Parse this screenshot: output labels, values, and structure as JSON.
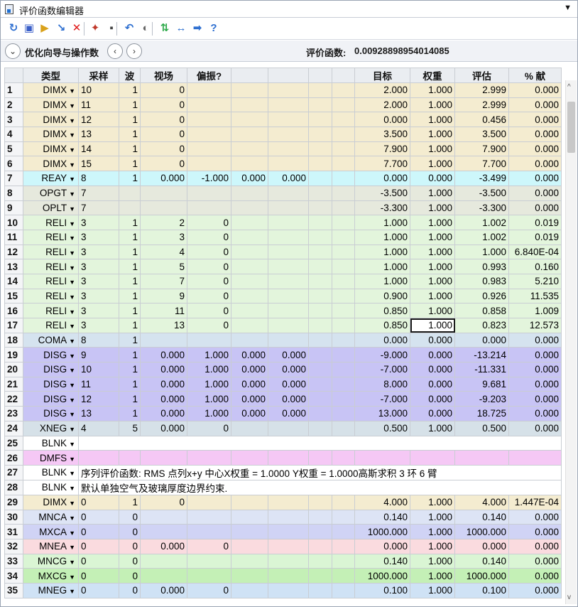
{
  "window": {
    "title": "评价函数编辑器",
    "dropdown_glyph": "▼"
  },
  "toolbar": {
    "buttons": [
      {
        "name": "refresh-icon",
        "glyph": "↻",
        "color": "#2e6fd0"
      },
      {
        "name": "save-icon",
        "glyph": "▣",
        "color": "#3a5fc8"
      },
      {
        "name": "load-icon",
        "glyph": "▶",
        "color": "#d9a11a"
      },
      {
        "name": "arrow-down-right-icon",
        "glyph": "↘",
        "color": "#2e6fd0"
      },
      {
        "name": "delete-icon",
        "glyph": "✕",
        "color": "#e01b1b"
      },
      {
        "name": "wizard-wand-icon",
        "glyph": "✦",
        "color": "#c0392b"
      },
      {
        "name": "page-icon",
        "glyph": "▪",
        "color": "#444444"
      },
      {
        "name": "undo-curve-icon",
        "glyph": "↶",
        "color": "#2e6fd0"
      },
      {
        "name": "toggle-icon",
        "glyph": "◐",
        "color": "#666666"
      },
      {
        "name": "swap-icon",
        "glyph": "⇅",
        "color": "#2eaa4b"
      },
      {
        "name": "expand-horizontal-icon",
        "glyph": "↔",
        "color": "#2e6fd0"
      },
      {
        "name": "arrow-right-icon",
        "glyph": "➡",
        "color": "#2e6fd0"
      },
      {
        "name": "help-icon",
        "glyph": "?",
        "color": "#2e6fd0"
      }
    ]
  },
  "wizard": {
    "toggle_glyph": "⌄",
    "label": "优化向导与操作数",
    "prev_glyph": "‹",
    "next_glyph": "›",
    "merit_label": "评价函数:",
    "merit_value": "0.00928898954014085"
  },
  "columns": [
    "类型",
    "采样",
    "波",
    "视场",
    "偏振?",
    "",
    "",
    "",
    "",
    "目标",
    "权重",
    "评估",
    "% 献"
  ],
  "rows": [
    {
      "n": "1",
      "type": "DIMX",
      "bg": "dimx",
      "c": [
        "10",
        "1",
        "0",
        "",
        "",
        "",
        "",
        ""
      ],
      "t": "2.000",
      "w": "1.000",
      "v": "2.999",
      "p": "0.000"
    },
    {
      "n": "2",
      "type": "DIMX",
      "bg": "dimx",
      "c": [
        "11",
        "1",
        "0",
        "",
        "",
        "",
        "",
        ""
      ],
      "t": "2.000",
      "w": "1.000",
      "v": "2.999",
      "p": "0.000"
    },
    {
      "n": "3",
      "type": "DIMX",
      "bg": "dimx",
      "c": [
        "12",
        "1",
        "0",
        "",
        "",
        "",
        "",
        ""
      ],
      "t": "0.000",
      "w": "1.000",
      "v": "0.456",
      "p": "0.000"
    },
    {
      "n": "4",
      "type": "DIMX",
      "bg": "dimx",
      "c": [
        "13",
        "1",
        "0",
        "",
        "",
        "",
        "",
        ""
      ],
      "t": "3.500",
      "w": "1.000",
      "v": "3.500",
      "p": "0.000"
    },
    {
      "n": "5",
      "type": "DIMX",
      "bg": "dimx",
      "c": [
        "14",
        "1",
        "0",
        "",
        "",
        "",
        "",
        ""
      ],
      "t": "7.900",
      "w": "1.000",
      "v": "7.900",
      "p": "0.000"
    },
    {
      "n": "6",
      "type": "DIMX",
      "bg": "dimx",
      "c": [
        "15",
        "1",
        "0",
        "",
        "",
        "",
        "",
        ""
      ],
      "t": "7.700",
      "w": "1.000",
      "v": "7.700",
      "p": "0.000"
    },
    {
      "n": "7",
      "type": "REAY",
      "bg": "reay",
      "c": [
        "8",
        "1",
        "0.000",
        "-1.000",
        "0.000",
        "0.000",
        "",
        ""
      ],
      "t": "0.000",
      "w": "0.000",
      "v": "-3.499",
      "p": "0.000"
    },
    {
      "n": "8",
      "type": "OPGT",
      "bg": "opgt",
      "c": [
        "7",
        "",
        "",
        "",
        "",
        "",
        "",
        ""
      ],
      "t": "-3.500",
      "w": "1.000",
      "v": "-3.500",
      "p": "0.000"
    },
    {
      "n": "9",
      "type": "OPLT",
      "bg": "opgt",
      "c": [
        "7",
        "",
        "",
        "",
        "",
        "",
        "",
        ""
      ],
      "t": "-3.300",
      "w": "1.000",
      "v": "-3.300",
      "p": "0.000"
    },
    {
      "n": "10",
      "type": "RELI",
      "bg": "reli",
      "c": [
        "3",
        "1",
        "2",
        "0",
        "",
        "",
        "",
        ""
      ],
      "t": "1.000",
      "w": "1.000",
      "v": "1.002",
      "p": "0.019"
    },
    {
      "n": "11",
      "type": "RELI",
      "bg": "reli",
      "c": [
        "3",
        "1",
        "3",
        "0",
        "",
        "",
        "",
        ""
      ],
      "t": "1.000",
      "w": "1.000",
      "v": "1.002",
      "p": "0.019"
    },
    {
      "n": "12",
      "type": "RELI",
      "bg": "reli",
      "c": [
        "3",
        "1",
        "4",
        "0",
        "",
        "",
        "",
        ""
      ],
      "t": "1.000",
      "w": "1.000",
      "v": "1.000",
      "p": "6.840E-04"
    },
    {
      "n": "13",
      "type": "RELI",
      "bg": "reli",
      "c": [
        "3",
        "1",
        "5",
        "0",
        "",
        "",
        "",
        ""
      ],
      "t": "1.000",
      "w": "1.000",
      "v": "0.993",
      "p": "0.160"
    },
    {
      "n": "14",
      "type": "RELI",
      "bg": "reli",
      "c": [
        "3",
        "1",
        "7",
        "0",
        "",
        "",
        "",
        ""
      ],
      "t": "1.000",
      "w": "1.000",
      "v": "0.983",
      "p": "5.210"
    },
    {
      "n": "15",
      "type": "RELI",
      "bg": "reli",
      "c": [
        "3",
        "1",
        "9",
        "0",
        "",
        "",
        "",
        ""
      ],
      "t": "0.900",
      "w": "1.000",
      "v": "0.926",
      "p": "11.535"
    },
    {
      "n": "16",
      "type": "RELI",
      "bg": "reli",
      "c": [
        "3",
        "1",
        "11",
        "0",
        "",
        "",
        "",
        ""
      ],
      "t": "0.850",
      "w": "1.000",
      "v": "0.858",
      "p": "1.009"
    },
    {
      "n": "17",
      "type": "RELI",
      "bg": "reli",
      "c": [
        "3",
        "1",
        "13",
        "0",
        "",
        "",
        "",
        ""
      ],
      "t": "0.850",
      "w": "1.000",
      "v": "0.823",
      "p": "12.573",
      "selected": "w"
    },
    {
      "n": "18",
      "type": "COMA",
      "bg": "coma",
      "c": [
        "8",
        "1",
        "",
        "",
        "",
        "",
        "",
        ""
      ],
      "t": "0.000",
      "w": "0.000",
      "v": "0.000",
      "p": "0.000"
    },
    {
      "n": "19",
      "type": "DISG",
      "bg": "disg",
      "c": [
        "9",
        "1",
        "0.000",
        "1.000",
        "0.000",
        "0.000",
        "",
        ""
      ],
      "t": "-9.000",
      "w": "0.000",
      "v": "-13.214",
      "p": "0.000"
    },
    {
      "n": "20",
      "type": "DISG",
      "bg": "disg",
      "c": [
        "10",
        "1",
        "0.000",
        "1.000",
        "0.000",
        "0.000",
        "",
        ""
      ],
      "t": "-7.000",
      "w": "0.000",
      "v": "-11.331",
      "p": "0.000"
    },
    {
      "n": "21",
      "type": "DISG",
      "bg": "disg",
      "c": [
        "11",
        "1",
        "0.000",
        "1.000",
        "0.000",
        "0.000",
        "",
        ""
      ],
      "t": "8.000",
      "w": "0.000",
      "v": "9.681",
      "p": "0.000"
    },
    {
      "n": "22",
      "type": "DISG",
      "bg": "disg",
      "c": [
        "12",
        "1",
        "0.000",
        "1.000",
        "0.000",
        "0.000",
        "",
        ""
      ],
      "t": "-7.000",
      "w": "0.000",
      "v": "-9.203",
      "p": "0.000"
    },
    {
      "n": "23",
      "type": "DISG",
      "bg": "disg",
      "c": [
        "13",
        "1",
        "0.000",
        "1.000",
        "0.000",
        "0.000",
        "",
        ""
      ],
      "t": "13.000",
      "w": "0.000",
      "v": "18.725",
      "p": "0.000"
    },
    {
      "n": "24",
      "type": "XNEG",
      "bg": "xneg",
      "c": [
        "4",
        "5",
        "0.000",
        "0",
        "",
        "",
        "",
        ""
      ],
      "t": "0.500",
      "w": "1.000",
      "v": "0.500",
      "p": "0.000"
    },
    {
      "n": "25",
      "type": "BLNK",
      "bg": "blnk",
      "comment": ""
    },
    {
      "n": "26",
      "type": "DMFS",
      "bg": "dmfs",
      "c": [
        "",
        "",
        "",
        "",
        "",
        "",
        "",
        ""
      ],
      "t": "",
      "w": "",
      "v": "",
      "p": ""
    },
    {
      "n": "27",
      "type": "BLNK",
      "bg": "blnk",
      "comment": "序列评价函数: RMS 点列x+y 中心X权重 = 1.0000 Y权重 = 1.0000高斯求积 3 环 6 臂"
    },
    {
      "n": "28",
      "type": "BLNK",
      "bg": "blnk",
      "comment": "默认单独空气及玻璃厚度边界约束."
    },
    {
      "n": "29",
      "type": "DIMX",
      "bg": "dimx",
      "c": [
        "0",
        "1",
        "0",
        "",
        "",
        "",
        "",
        ""
      ],
      "t": "4.000",
      "w": "1.000",
      "v": "4.000",
      "p": "1.447E-04"
    },
    {
      "n": "30",
      "type": "MNCA",
      "bg": "mnca",
      "c": [
        "0",
        "0",
        "",
        "",
        "",
        "",
        "",
        ""
      ],
      "t": "0.140",
      "w": "1.000",
      "v": "0.140",
      "p": "0.000"
    },
    {
      "n": "31",
      "type": "MXCA",
      "bg": "mxca",
      "c": [
        "0",
        "0",
        "",
        "",
        "",
        "",
        "",
        ""
      ],
      "t": "1000.000",
      "w": "1.000",
      "v": "1000.000",
      "p": "0.000"
    },
    {
      "n": "32",
      "type": "MNEA",
      "bg": "mnea",
      "c": [
        "0",
        "0",
        "0.000",
        "0",
        "",
        "",
        "",
        ""
      ],
      "t": "0.000",
      "w": "1.000",
      "v": "0.000",
      "p": "0.000"
    },
    {
      "n": "33",
      "type": "MNCG",
      "bg": "mncg",
      "c": [
        "0",
        "0",
        "",
        "",
        "",
        "",
        "",
        ""
      ],
      "t": "0.140",
      "w": "1.000",
      "v": "0.140",
      "p": "0.000"
    },
    {
      "n": "34",
      "type": "MXCG",
      "bg": "mxcg",
      "c": [
        "0",
        "0",
        "",
        "",
        "",
        "",
        "",
        ""
      ],
      "t": "1000.000",
      "w": "1.000",
      "v": "1000.000",
      "p": "0.000"
    },
    {
      "n": "35",
      "type": "MNEG",
      "bg": "mneg",
      "c": [
        "0",
        "0",
        "0.000",
        "0",
        "",
        "",
        "",
        ""
      ],
      "t": "0.100",
      "w": "1.000",
      "v": "0.100",
      "p": "0.000"
    }
  ],
  "scrollbar": {
    "up_glyph": "^",
    "down_glyph": "v"
  },
  "dropdown_glyph": "▼"
}
